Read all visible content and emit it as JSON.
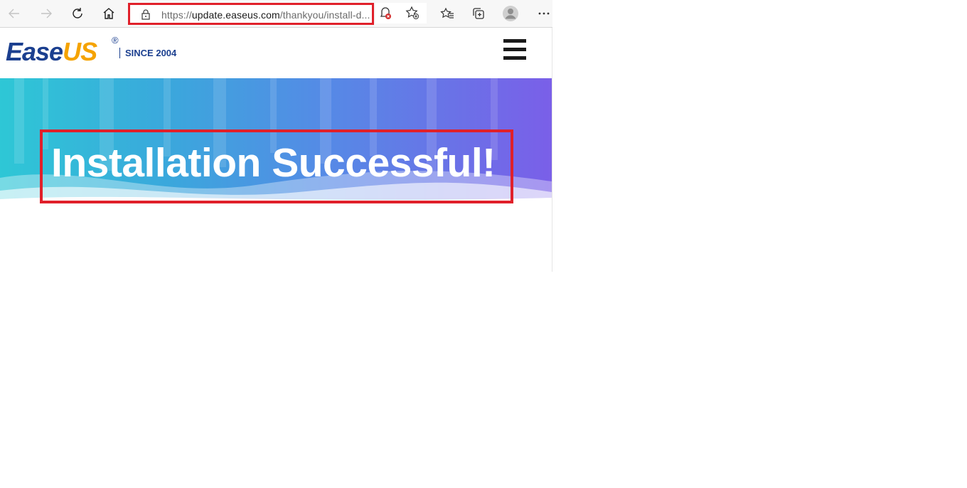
{
  "browser": {
    "url_prefix": "https://",
    "url_host": "update.easeus.com",
    "url_path": "/thankyou/install-d...",
    "icons": [
      "back-icon",
      "forward-icon",
      "refresh-icon",
      "home-icon",
      "lock-icon",
      "tracking-prevention-icon",
      "add-favorite-icon",
      "favorites-icon",
      "collections-icon",
      "profile-icon",
      "more-icon"
    ]
  },
  "site": {
    "logo_ease": "Ease",
    "logo_us": "US",
    "logo_reg": "®",
    "since": "SINCE 2004"
  },
  "hero": {
    "title": "Installation Successful!"
  },
  "colors": {
    "brand_blue": "#1b3f8f",
    "brand_orange": "#f5a300",
    "highlight_red": "#e0202a",
    "hero_gradient_start": "#2ec7d6",
    "hero_gradient_end": "#7a5fe8"
  }
}
